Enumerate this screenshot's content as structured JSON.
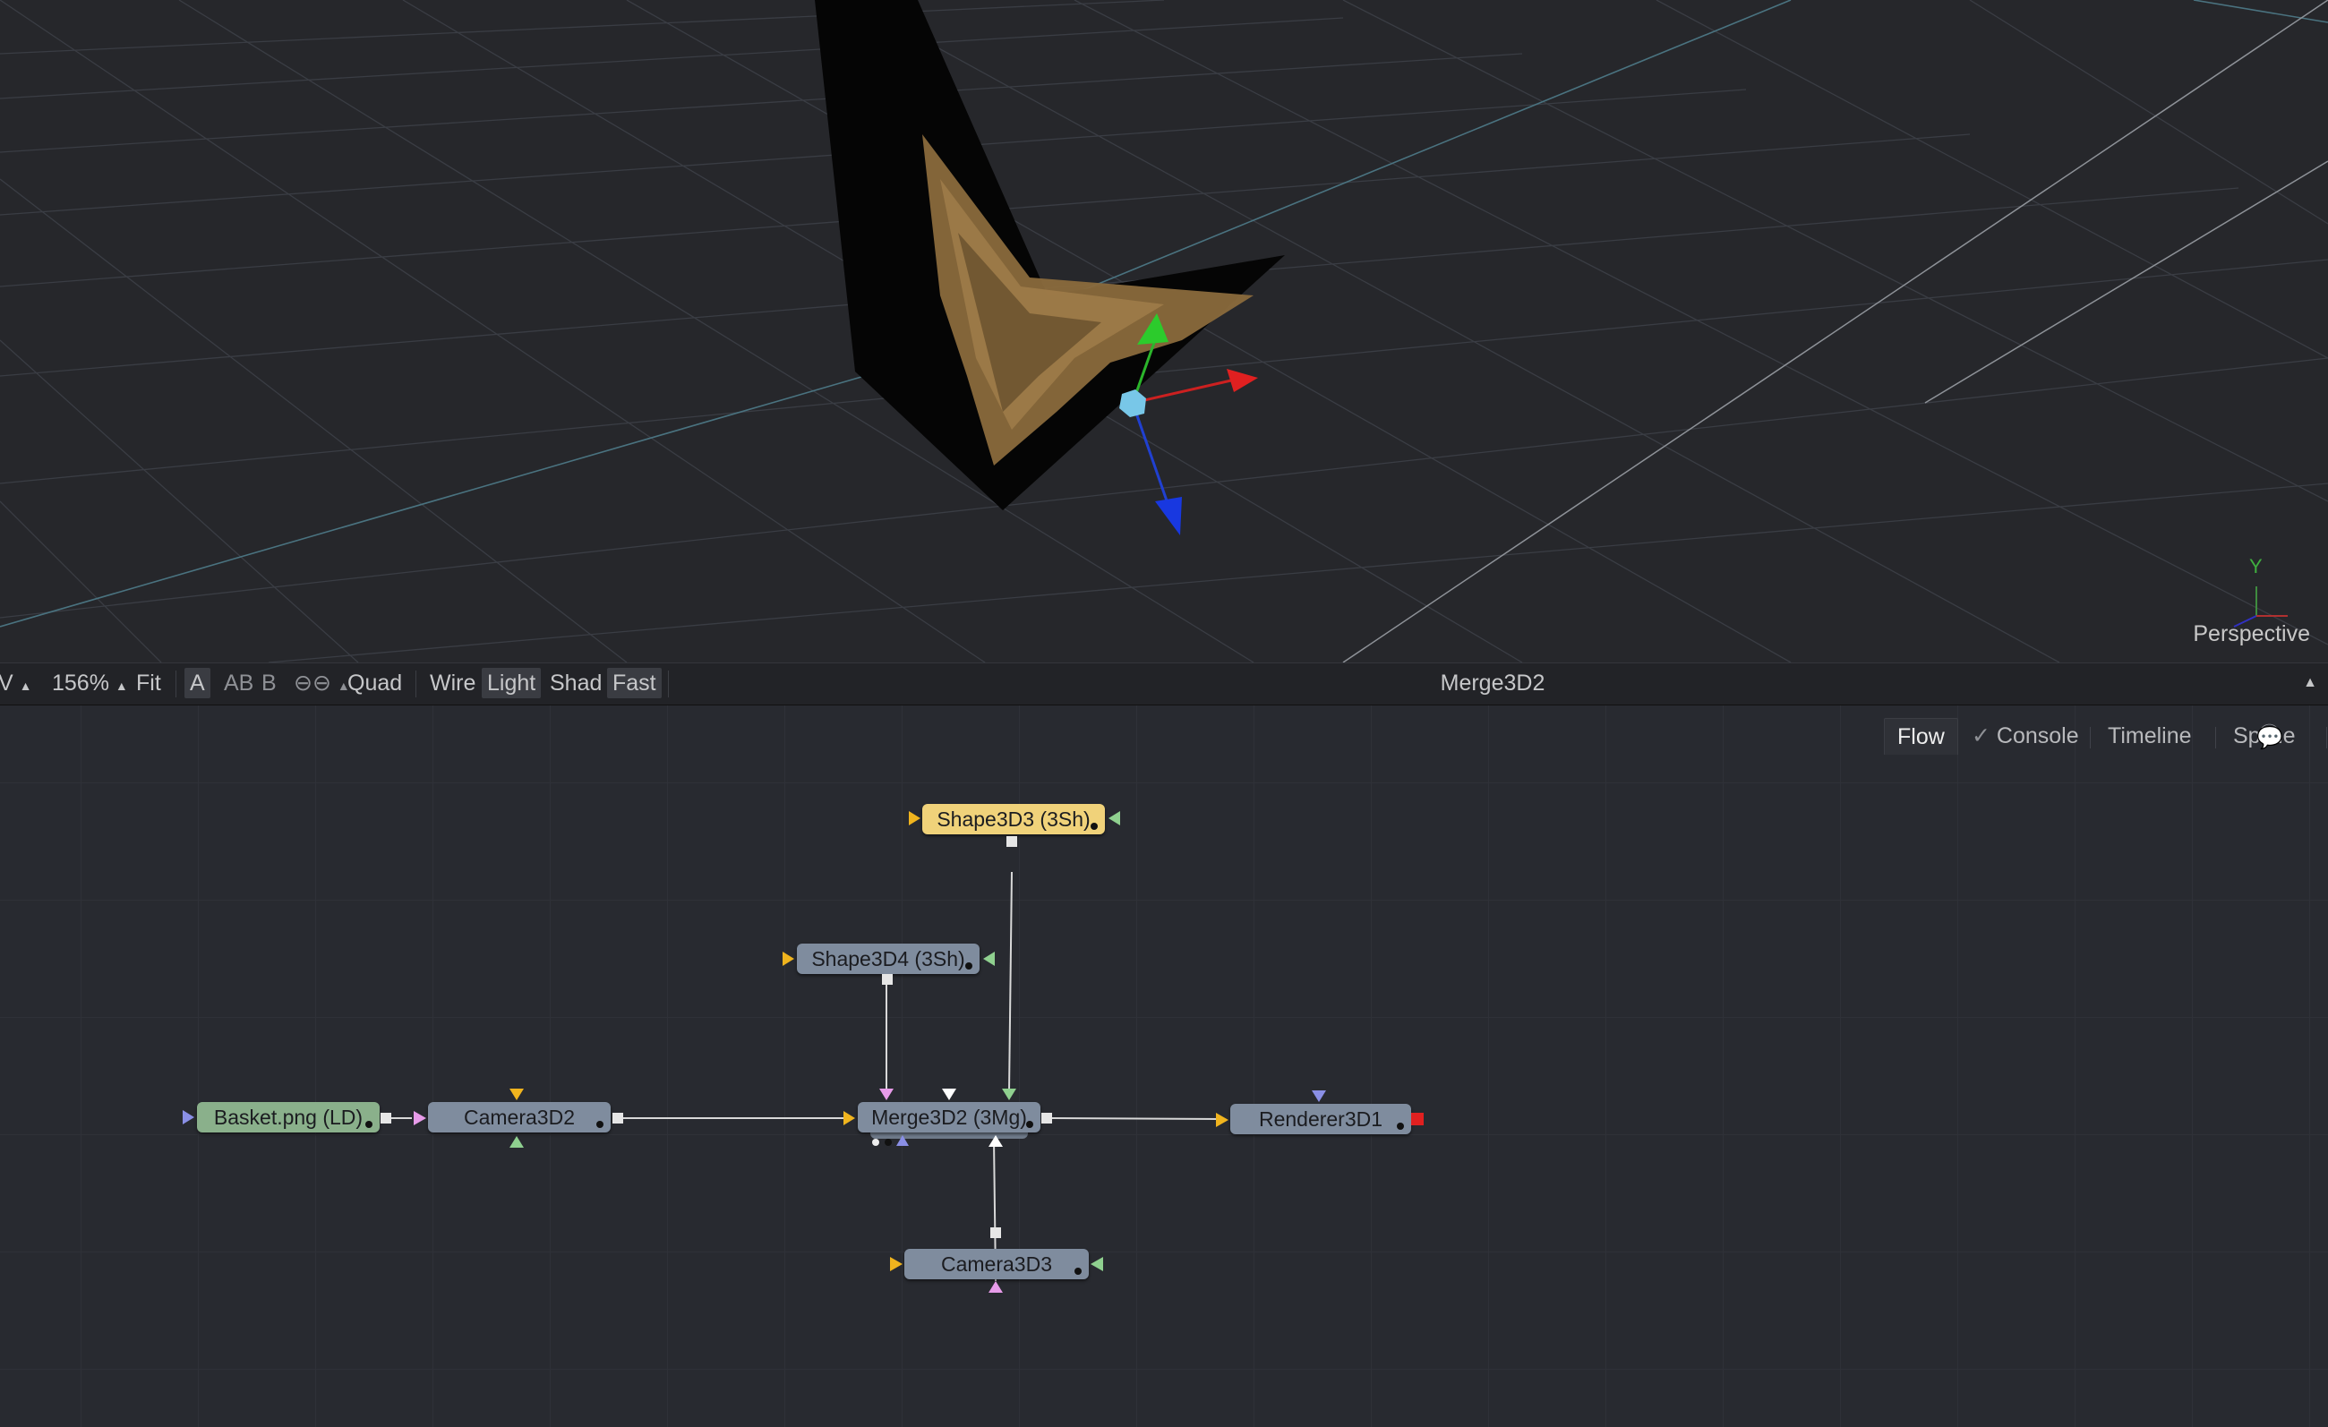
{
  "viewer": {
    "view_label": "Perspective",
    "axis_label": "Y"
  },
  "toolbar": {
    "left_clip": "V",
    "zoom": "156%",
    "fit": "Fit",
    "a": "A",
    "ab": "AB",
    "b": "B",
    "quad": "Quad",
    "wire": "Wire",
    "light": "Light",
    "shad": "Shad",
    "fast": "Fast",
    "current_node": "Merge3D2"
  },
  "tabs": {
    "flow": "Flow",
    "console": "Console",
    "timeline": "Timeline",
    "spline": "Spline"
  },
  "nodes": {
    "basket": "Basket.png  (LD)",
    "camera3d2": "Camera3D2",
    "shape3d3": "Shape3D3  (3Sh)",
    "shape3d4": "Shape3D4  (3Sh)",
    "merge3d2": "Merge3D2  (3Mg)",
    "renderer3d1": "Renderer3D1",
    "camera3d3": "Camera3D3"
  },
  "colors": {
    "node_grey": "#7f8c9e",
    "node_loader": "#8ab08b",
    "node_selected": "#f0d27a",
    "input_orange": "#f0b41e",
    "input_green": "#8fd08f",
    "input_pink": "#e79be9",
    "output_red": "#e02020"
  }
}
